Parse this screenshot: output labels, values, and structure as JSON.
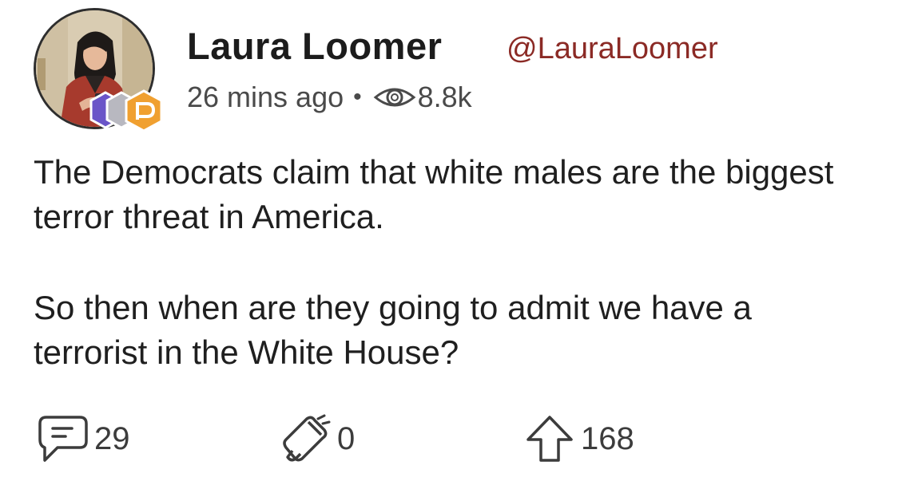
{
  "post": {
    "author": {
      "name": "Laura Loomer",
      "handle": "@LauraLoomer",
      "avatar_icon": "profile-photo",
      "badge_icons": [
        "hexagon-badge-purple",
        "hexagon-badge-gray",
        "parler-p-badge-orange"
      ]
    },
    "meta": {
      "time": "26 mins ago",
      "separator": "•",
      "views": "8.8k",
      "views_icon": "eye-icon"
    },
    "body": {
      "paragraph_1": "The Democrats claim that white males are the biggest terror threat in America.",
      "paragraph_2": "So then when are they going to admit we have a terrorist in the White House?"
    },
    "actions": {
      "comments": "29",
      "comments_icon": "comment-icon",
      "echoes": "0",
      "echoes_icon": "megaphone-icon",
      "upvotes": "168",
      "upvotes_icon": "upvote-arrow-icon"
    }
  },
  "colors": {
    "handle": "#8b2a25",
    "text": "#1f1f1f",
    "muted": "#4a4a4a",
    "badge_orange": "#f0a030",
    "badge_purple": "#6a55c8"
  }
}
